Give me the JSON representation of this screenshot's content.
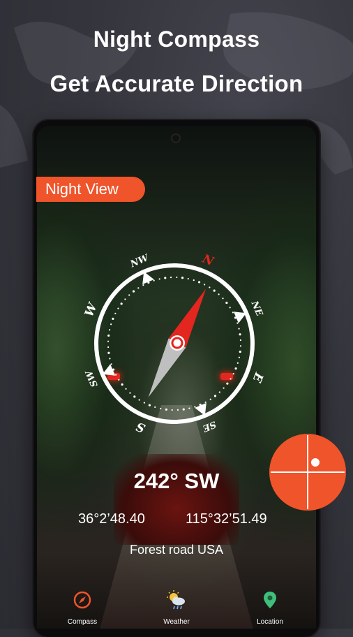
{
  "promo": {
    "title": "Night Compass",
    "subtitle": "Get Accurate Direction"
  },
  "badge": {
    "label": "Night View"
  },
  "compass": {
    "directions": [
      "N",
      "NE",
      "E",
      "SE",
      "S",
      "SW",
      "W",
      "NW"
    ],
    "heading": "242° SW",
    "latitude": "36°2’48.40",
    "longitude": "115°32’51.49",
    "location_name": "Forest road USA"
  },
  "bottom_nav": {
    "items": [
      {
        "label": "Compass",
        "icon": "compass-icon"
      },
      {
        "label": "Weather",
        "icon": "weather-icon"
      },
      {
        "label": "Location",
        "icon": "location-pin-icon"
      }
    ]
  },
  "colors": {
    "accent": "#f0542b",
    "needle_north": "#e3261f",
    "needle_south": "#bfbfbf",
    "background": "#35353d",
    "location_green": "#3fbf7a",
    "weather_yellow": "#f5c43a"
  }
}
